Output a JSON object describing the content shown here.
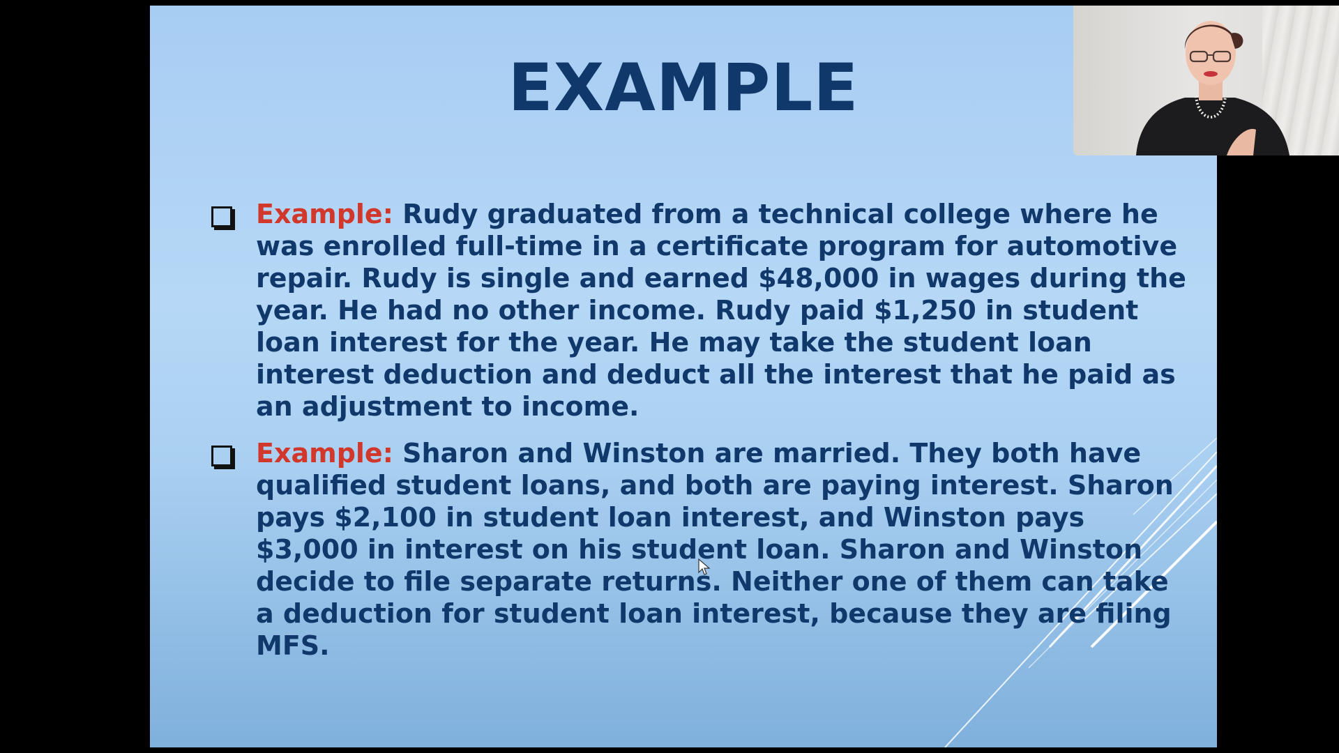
{
  "slide": {
    "title": "EXAMPLE",
    "bullets": [
      {
        "lead": "Example:",
        "text": " Rudy graduated from a technical college where he was enrolled full-time in a certificate program for automotive repair. Rudy is single and earned $48,000 in wages during the year. He had no other income. Rudy paid $1,250 in student loan interest for the year. He may take the student loan interest deduction and deduct all the interest that he paid as an adjustment to income."
      },
      {
        "lead": "Example:",
        "text": " Sharon and Winston are married. They both have qualified student loans, and both are paying interest. Sharon pays $2,100 in student loan interest, and Winston pays $3,000 in interest on his student loan. Sharon and Winston decide to file separate returns. Neither one of them can take a deduction for student loan interest, because they are filing MFS."
      }
    ]
  },
  "colors": {
    "title": "#10386a",
    "body_text": "#10386a",
    "lead_text": "#d2372b",
    "background_top": "#a8cdf3",
    "background_bottom": "#7fb0dc"
  },
  "icons": {
    "bullet": "checkbox-bullet-icon",
    "cursor": "mouse-pointer-icon"
  }
}
